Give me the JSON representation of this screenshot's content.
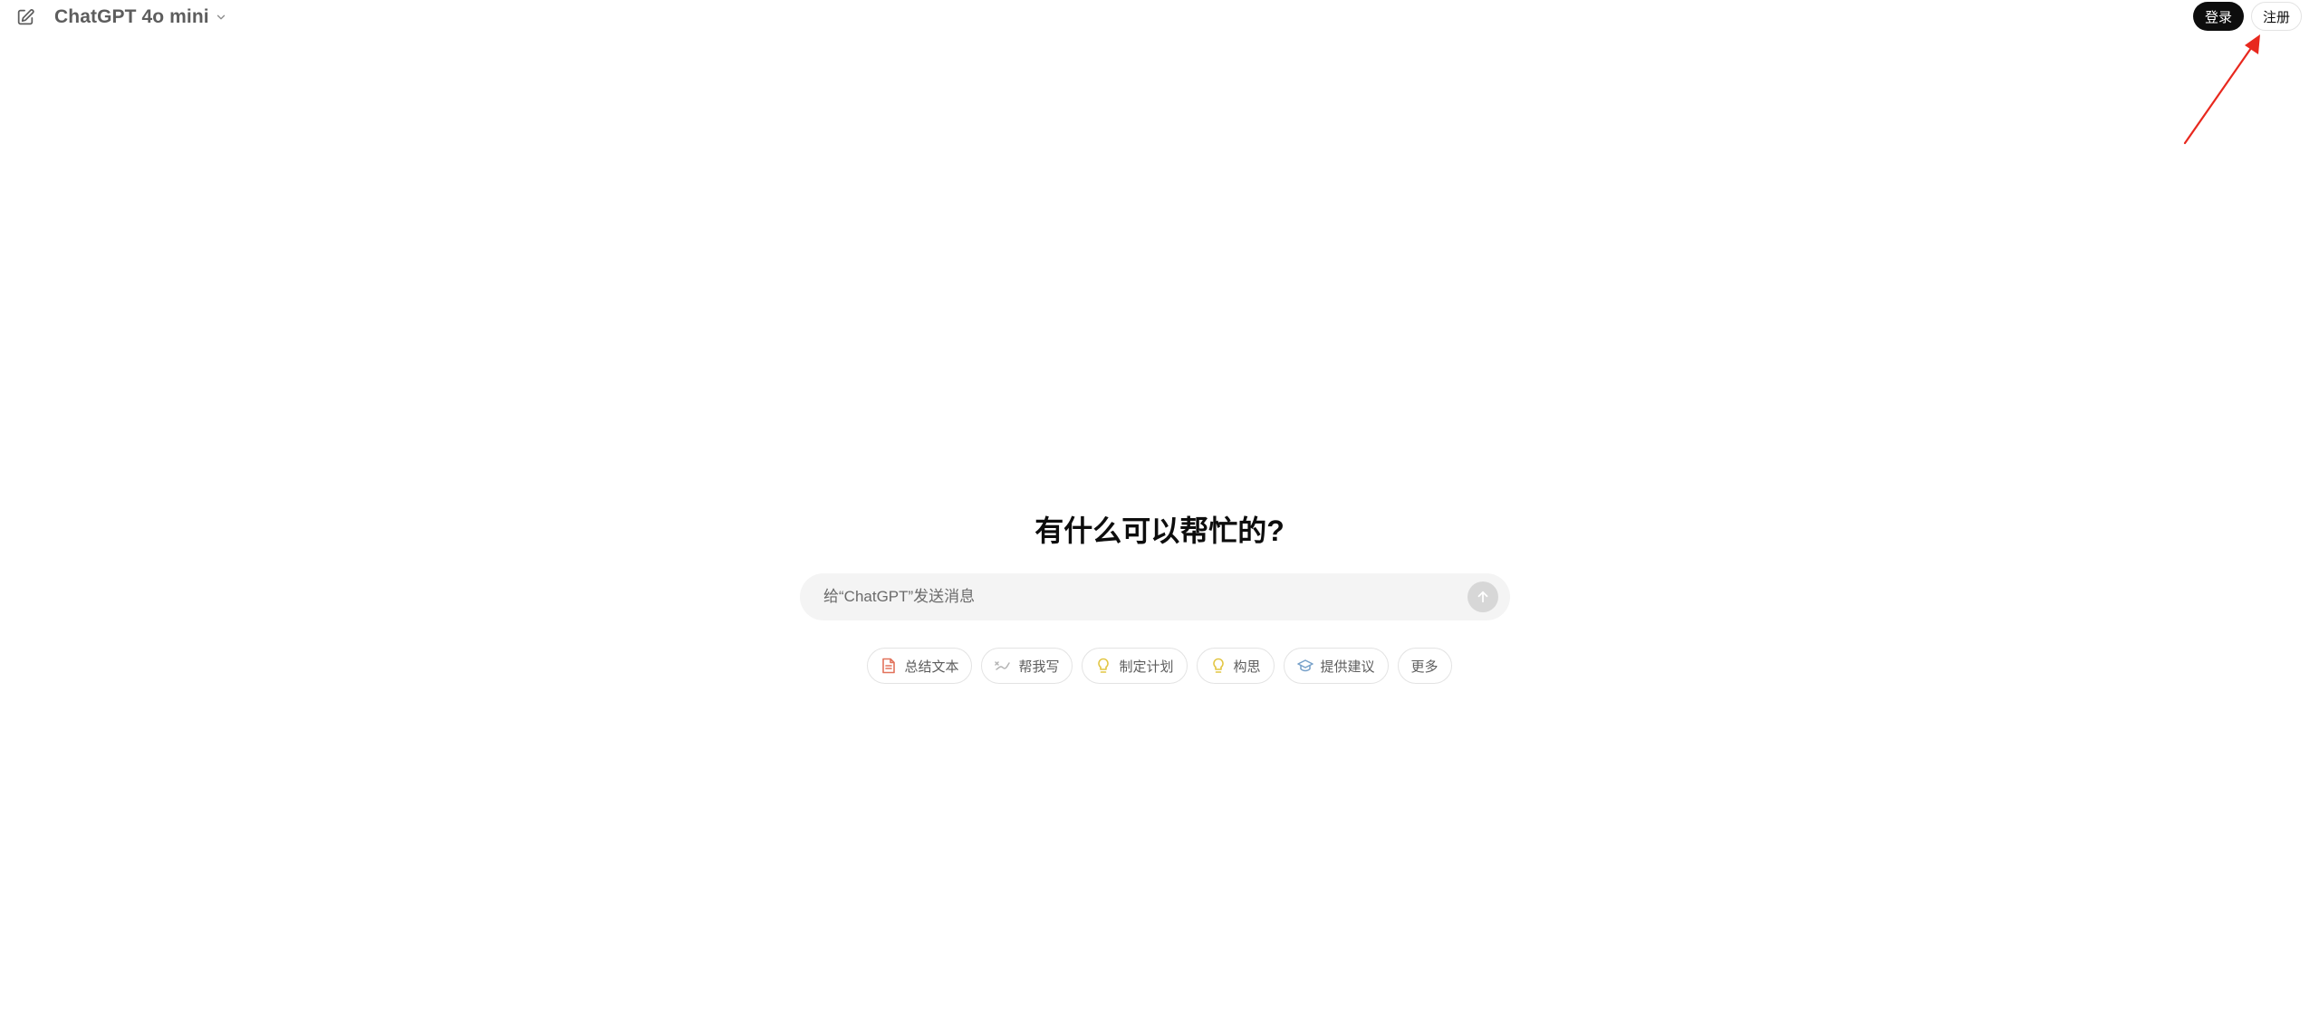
{
  "header": {
    "model_name": "ChatGPT 4o mini",
    "login_label": "登录",
    "signup_label": "注册"
  },
  "main": {
    "title": "有什么可以帮忙的?",
    "composer": {
      "placeholder": "给“ChatGPT”发送消息",
      "value": ""
    },
    "chips": [
      {
        "label": "总结文本",
        "icon": "document-icon",
        "color": "#e2725b"
      },
      {
        "label": "帮我写",
        "icon": "pen-icon",
        "color": "#b4b4b4"
      },
      {
        "label": "制定计划",
        "icon": "lightbulb-icon",
        "color": "#e2c541"
      },
      {
        "label": "构思",
        "icon": "lightbulb-icon",
        "color": "#e2c541"
      },
      {
        "label": "提供建议",
        "icon": "graduation-cap-icon",
        "color": "#76a0c9"
      },
      {
        "label": "更多",
        "icon": "",
        "color": ""
      }
    ]
  },
  "annotation": {
    "arrow_color": "#e8281e"
  }
}
